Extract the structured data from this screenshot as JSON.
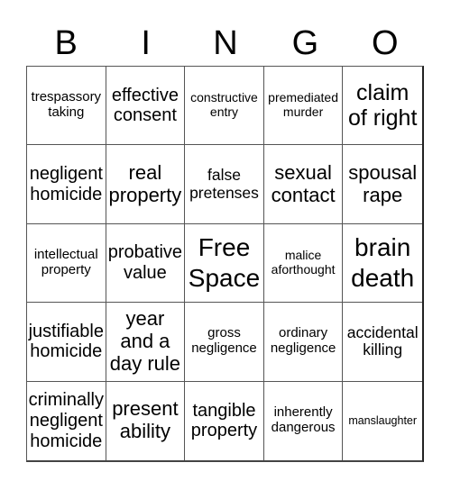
{
  "header": {
    "letters": [
      "B",
      "I",
      "N",
      "G",
      "O"
    ]
  },
  "grid": {
    "rows": [
      [
        "trespassory taking",
        "effective consent",
        "constructive entry",
        "premediated murder",
        "claim of right"
      ],
      [
        "negligent homicide",
        "real property",
        "false pretenses",
        "sexual contact",
        "spousal rape"
      ],
      [
        "intellectual property",
        "probative value",
        "Free Space",
        "malice aforthought",
        "brain death"
      ],
      [
        "justifiable homicide",
        "year and a day rule",
        "gross negligence",
        "ordinary negligence",
        "accidental killing"
      ],
      [
        "criminally negligent homicide",
        "present ability",
        "tangible property",
        "inherently dangerous",
        "manslaughter"
      ]
    ]
  }
}
